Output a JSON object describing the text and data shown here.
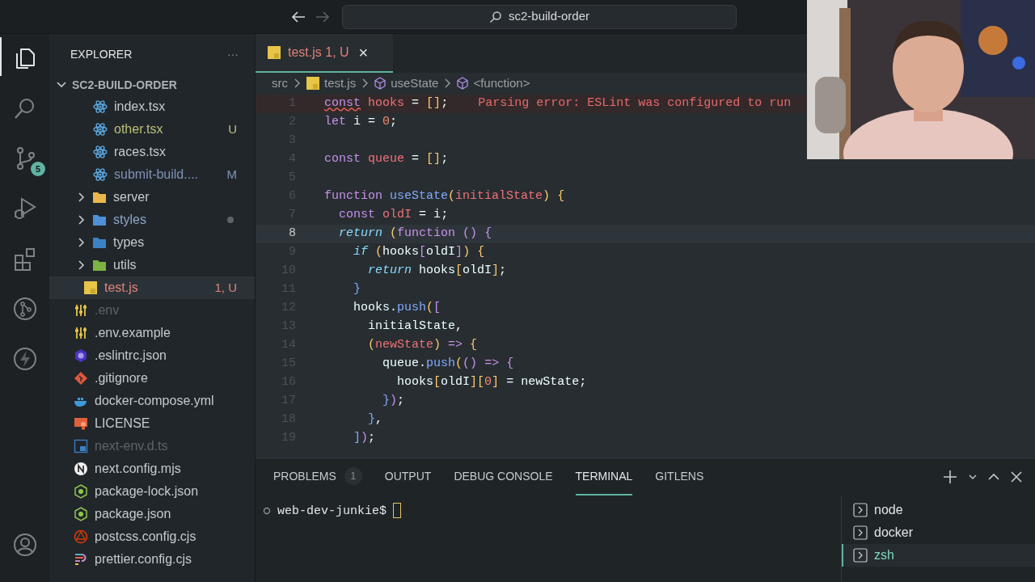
{
  "title_bar": {
    "search": "sc2-build-order",
    "back_enabled": true,
    "forward_enabled": false
  },
  "activity_bar": [
    {
      "kind": "files",
      "selected": true
    },
    {
      "kind": "search",
      "selected": false
    },
    {
      "kind": "source-control",
      "selected": false,
      "badge": "5"
    },
    {
      "kind": "run",
      "selected": false
    },
    {
      "kind": "extensions",
      "selected": false
    },
    {
      "kind": "git-graph",
      "selected": false
    },
    {
      "kind": "bolt",
      "selected": false
    },
    {
      "kind": "account",
      "selected": false
    }
  ],
  "explorer": {
    "title": "EXPLORER",
    "more": "···",
    "root": {
      "label": "SC2-BUILD-ORDER",
      "expanded": true,
      "children": [
        {
          "children": [
            {
              "children": [
                {
                  "label": "index.tsx",
                  "kind": "react",
                  "color": "#c5cace"
                },
                {
                  "label": "other.tsx",
                  "kind": "react",
                  "color": "#b9c07a",
                  "badge": "U"
                },
                {
                  "label": "races.tsx",
                  "kind": "react",
                  "color": "#c5cace"
                },
                {
                  "label": "submit-build....",
                  "kind": "react",
                  "color": "#7f93b8",
                  "badge": "M"
                }
              ]
            },
            {
              "label": "server",
              "kind": "serverfolder",
              "expanded": false,
              "color": "#c5cace",
              "dot": false
            },
            {
              "label": "styles",
              "kind": "stylesfolder",
              "expanded": false,
              "color": "#8fa5c8",
              "dot": true
            },
            {
              "label": "types",
              "kind": "typesfolder",
              "expanded": false,
              "color": "#c5cace",
              "dot": false
            },
            {
              "label": "utils",
              "kind": "utilsfolder",
              "expanded": false,
              "color": "#c5cace",
              "dot": false
            },
            {
              "label": "test.js",
              "kind": "js",
              "color": "#e0827a",
              "badge": "1, U",
              "selected": true,
              "dot": false
            }
          ]
        },
        {
          "label": ".env",
          "kind": "env",
          "color": "#5d6469"
        },
        {
          "label": ".env.example",
          "kind": "env",
          "color": "#c5cace"
        },
        {
          "label": ".eslintrc.json",
          "kind": "eslint",
          "color": "#c5cace"
        },
        {
          "label": ".gitignore",
          "kind": "git",
          "color": "#c5cace"
        },
        {
          "label": "docker-compose.yml",
          "kind": "docker",
          "color": "#c5cace"
        },
        {
          "label": "LICENSE",
          "kind": "license",
          "color": "#c5cace"
        },
        {
          "label": "next-env.d.ts",
          "kind": "ts",
          "color": "#5d6469"
        },
        {
          "label": "next.config.mjs",
          "kind": "next",
          "color": "#c5cace"
        },
        {
          "label": "package-lock.json",
          "kind": "node",
          "color": "#c5cace"
        },
        {
          "label": "package.json",
          "kind": "node",
          "color": "#c5cace"
        },
        {
          "label": "postcss.config.cjs",
          "kind": "postcss",
          "color": "#c5cace"
        },
        {
          "label": "prettier.config.cjs",
          "kind": "prettier",
          "color": "#c5cace"
        }
      ]
    }
  },
  "editor": {
    "tab": {
      "label": "test.js",
      "status": "1, U",
      "close": "×"
    },
    "breadcrumbs": [
      {
        "label": "src",
        "kind": "none"
      },
      {
        "label": "test.js",
        "kind": "js"
      },
      {
        "label": "useState",
        "kind": "symbol"
      },
      {
        "label": "<function>",
        "kind": "symbol"
      }
    ],
    "lines": [
      {
        "number": "1",
        "current": false,
        "text": "const hooks = [];",
        "diagnostic": "Parsing error: ESLint was configured to run"
      },
      {
        "number": "2",
        "current": false,
        "text": "let i = 0;"
      },
      {
        "number": "3",
        "current": false
      },
      {
        "number": "4",
        "current": false,
        "text": "const queue = [];"
      },
      {
        "number": "5",
        "current": false
      },
      {
        "number": "6",
        "current": false,
        "text": "function useState(initialState) {"
      },
      {
        "number": "7",
        "current": false,
        "text": "  const oldI = i;"
      },
      {
        "number": "8",
        "current": true,
        "text": "  return (function () {"
      },
      {
        "number": "9",
        "current": false,
        "text": "    if (hooks[oldI]) {"
      },
      {
        "number": "10",
        "current": false,
        "text": "      return hooks[oldI];"
      },
      {
        "number": "11",
        "current": false,
        "text": "    }"
      },
      {
        "number": "12",
        "current": false,
        "text": "    hooks.push(["
      },
      {
        "number": "13",
        "current": false,
        "text": "      initialState,"
      },
      {
        "number": "14",
        "current": false,
        "text": "      (newState) => {"
      },
      {
        "number": "15",
        "current": false,
        "text": "        queue.push(() => {"
      },
      {
        "number": "16",
        "current": false,
        "text": "          hooks[oldI][0] = newState;"
      },
      {
        "number": "17",
        "current": false,
        "text": "        });"
      },
      {
        "number": "18",
        "current": false,
        "text": "      },"
      },
      {
        "number": "19",
        "current": false,
        "text": "    ]);"
      }
    ]
  },
  "panel": {
    "tabs": [
      {
        "label": "PROBLEMS",
        "count": "1",
        "selected": false
      },
      {
        "label": "OUTPUT",
        "selected": false
      },
      {
        "label": "DEBUG CONSOLE",
        "selected": false
      },
      {
        "label": "TERMINAL",
        "selected": true
      },
      {
        "label": "GITLENS",
        "selected": false
      }
    ],
    "prompt": "web-dev-junkie$",
    "terminals": [
      {
        "label": "node",
        "selected": false
      },
      {
        "label": "docker",
        "selected": false
      },
      {
        "label": "zsh",
        "selected": true
      }
    ]
  }
}
